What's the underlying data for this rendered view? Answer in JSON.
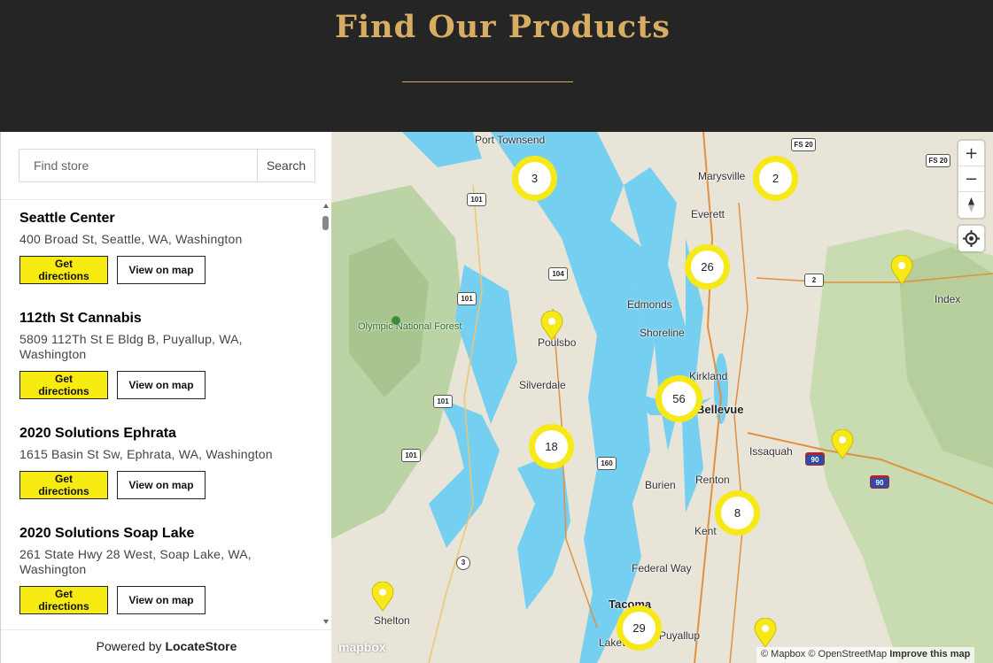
{
  "header": {
    "title": "Find Our Products"
  },
  "search": {
    "placeholder": "Find store",
    "button_label": "Search"
  },
  "stores": [
    {
      "name": "Seattle Center",
      "address": "400 Broad St, Seattle, WA, Washington"
    },
    {
      "name": "112th St Cannabis",
      "address": "5809 112Th St E Bldg B, Puyallup, WA, Washington"
    },
    {
      "name": "2020 Solutions Ephrata",
      "address": "1615 Basin St Sw, Ephrata, WA, Washington"
    },
    {
      "name": "2020 Solutions Soap Lake",
      "address": "261 State Hwy 28 West, Soap Lake, WA, Washington"
    }
  ],
  "store_buttons": {
    "directions": "Get directions",
    "view_map": "View on map"
  },
  "footer": {
    "prefix": "Powered by ",
    "brand": "LocateStore"
  },
  "map": {
    "places": [
      "Port Townsend",
      "Marysville",
      "Everett",
      "Edmonds",
      "Shoreline",
      "Poulsbo",
      "Silverdale",
      "Kirkland",
      "Bellevue",
      "Issaquah",
      "Burien",
      "Renton",
      "Kent",
      "Federal Way",
      "Tacoma",
      "Lakewood",
      "Puyallup",
      "Shelton",
      "Index",
      "Olympic National Forest"
    ],
    "shields": [
      "FS 20",
      "FS 20",
      "101",
      "101",
      "101",
      "101",
      "104",
      "2",
      "160",
      "3",
      "90",
      "90"
    ],
    "clusters": [
      "3",
      "2",
      "26",
      "56",
      "18",
      "8",
      "29"
    ],
    "controls": {
      "zoom_in": "+",
      "zoom_out": "−"
    },
    "attribution": {
      "mapbox": "© Mapbox",
      "osm": "© OpenStreetMap",
      "improve": "Improve this map"
    },
    "logo": "mapbox"
  },
  "colors": {
    "header_bg": "#262526",
    "gold": "#d7ad63",
    "yellow": "#f7e818",
    "water": "#75cff0",
    "land": "#e9e4d8"
  }
}
